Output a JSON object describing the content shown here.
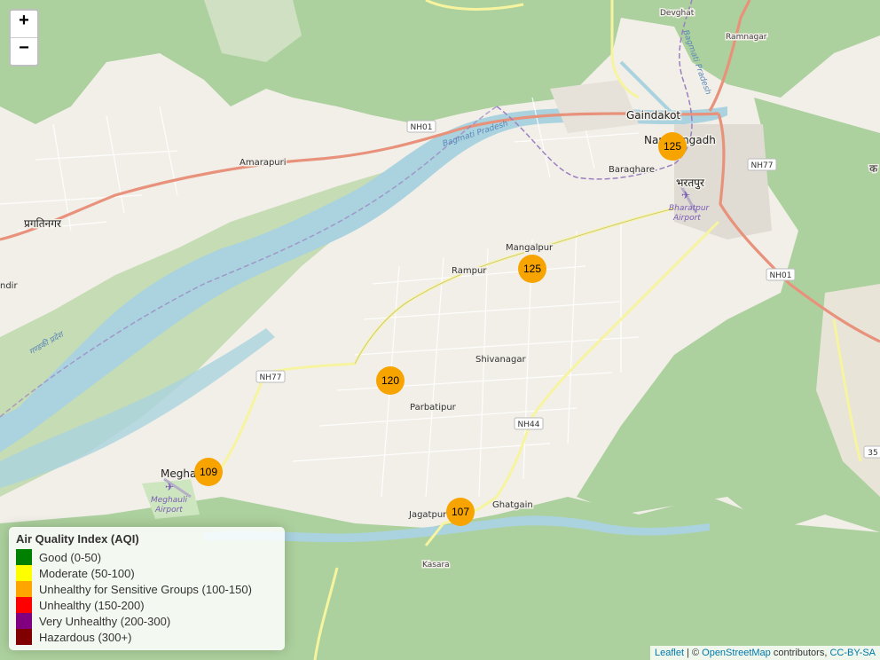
{
  "map": {
    "zoom_in": "+",
    "zoom_out": "−",
    "places": {
      "devghat": "Devghat",
      "ramnagar": "Ramnagar",
      "gaindakot": "Gaindakot",
      "narayangadh": "Narayangadh",
      "baraqhare": "Baraqhare",
      "bharatpur": "भरतपुर",
      "amarapuri": "Amarapuri",
      "pragatinagar": "प्रगतिनगर",
      "mangalpur": "Mangalpur",
      "rampur": "Rampur",
      "shivanagar": "Shivanagar",
      "parbatipur": "Parbatipur",
      "meghauli": "Meghauli",
      "jagatpur": "Jagatpur",
      "ghatgain": "Ghatgain",
      "kasara": "Kasara",
      "ka": "क",
      "andir": "ndir"
    },
    "airports": {
      "bharatpur_line1": "Bharatpur",
      "bharatpur_line2": "Airport",
      "meghauli_line1": "Meghauli",
      "meghauli_line2": "Airport"
    },
    "rivers": {
      "bagmati1": "Bagmati Pradesh",
      "bagmati2": "Bagmati Pradesh",
      "bagmati3": "Bagmati Pradesh",
      "gandaki": "गण्डकी प्रदेश"
    },
    "roads": {
      "nh01_a": "NH01",
      "nh01_b": "NH01",
      "nh77_a": "NH77",
      "nh77_b": "NH77",
      "nh44": "NH44",
      "r35": "35"
    }
  },
  "markers": [
    {
      "id": "marker-narayangadh",
      "aqi": "125"
    },
    {
      "id": "marker-mangalpur",
      "aqi": "125"
    },
    {
      "id": "marker-parbatipur",
      "aqi": "120"
    },
    {
      "id": "marker-meghauli",
      "aqi": "109"
    },
    {
      "id": "marker-jagatpur",
      "aqi": "107"
    }
  ],
  "legend": {
    "title": "Air Quality Index (AQI)",
    "items": [
      {
        "label": "Good (0-50)",
        "color": "#008000"
      },
      {
        "label": "Moderate (50-100)",
        "color": "#ffff00"
      },
      {
        "label": "Unhealthy for Sensitive Groups (100-150)",
        "color": "#ffa500"
      },
      {
        "label": "Unhealthy (150-200)",
        "color": "#ff0000"
      },
      {
        "label": "Very Unhealthy (200-300)",
        "color": "#800080"
      },
      {
        "label": "Hazardous (300+)",
        "color": "#800000"
      }
    ]
  },
  "attribution": {
    "leaflet": "Leaflet",
    "sep1": " | © ",
    "osm": "OpenStreetMap",
    "contributors": " contributors, ",
    "license": "CC-BY-SA"
  },
  "colors": {
    "marker": "#f7a400",
    "forest": "#add19e",
    "water": "#aad3df",
    "land": "#f2efe9"
  }
}
